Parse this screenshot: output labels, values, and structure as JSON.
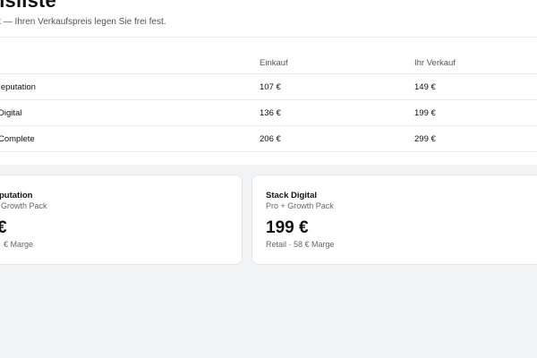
{
  "header": {
    "title": "reisliste",
    "subtitle": "k — Ihren Verkaufspreis legen Sie frei fest."
  },
  "table": {
    "columns": [
      "Einkauf",
      "Ihr Verkauf"
    ],
    "rows": [
      {
        "name": "Reputation",
        "einkauf": "107 €",
        "verkauf": "149 €"
      },
      {
        "name": "Digital",
        "einkauf": "136 €",
        "verkauf": "199 €"
      },
      {
        "name": "Complete",
        "einkauf": "206 €",
        "verkauf": "299 €"
      }
    ]
  },
  "cards": [
    {
      "title": "putation",
      "sub": "Growth Pack",
      "price": "€",
      "meta": "€ Marge"
    },
    {
      "title": "Stack Digital",
      "sub": "Pro + Growth Pack",
      "price": "199 €",
      "meta": "Retail · 58 € Marge"
    }
  ]
}
